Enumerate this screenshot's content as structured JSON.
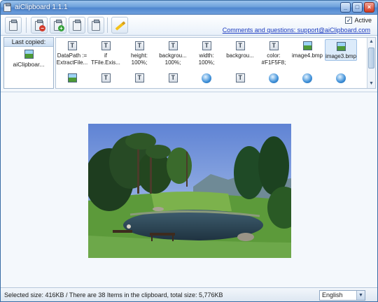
{
  "window": {
    "title": "aiClipboard 1.1.1",
    "minimize": "_",
    "maximize": "□",
    "close": "×"
  },
  "toolbar": {
    "active_label": "Active",
    "active_checked": "✓",
    "comments_link": "Comments and questions: support@aiClipboard.com",
    "buttons": [
      "clipboard-icon",
      "delete-item-icon",
      "add-item-icon",
      "copy-icon",
      "paste-icon",
      "pencil-icon"
    ]
  },
  "last_copied": {
    "header": "Last copied:",
    "item_label": "aiClipboar..."
  },
  "items": {
    "row1": [
      {
        "label": "DataPath :=\nExtractFile...",
        "icon": "text-icon"
      },
      {
        "label": "if\nTFile.Exis...",
        "icon": "text-icon"
      },
      {
        "label": "height:\n100%;",
        "icon": "text-icon"
      },
      {
        "label": "backgrou...\n100%;",
        "icon": "text-icon"
      },
      {
        "label": "width:\n100%;",
        "icon": "text-icon"
      },
      {
        "label": "backgrou...",
        "icon": "text-icon"
      },
      {
        "label": "color:\n#F1F5F8;",
        "icon": "text-icon"
      },
      {
        "label": "image4.bmp",
        "icon": "image-icon"
      },
      {
        "label": "image3.bmp",
        "icon": "image-icon",
        "selected": true
      }
    ],
    "row2_icons": [
      "image-icon",
      "text-icon",
      "text-icon",
      "text-icon",
      "globe-icon",
      "text-icon",
      "globe-icon",
      "globe-icon",
      "globe-icon"
    ]
  },
  "status": {
    "text": "Selected size: 416KB / There are 38 Items in the clipboard, total size: 5,776KB",
    "language": "English",
    "language_arrow": "▼"
  }
}
